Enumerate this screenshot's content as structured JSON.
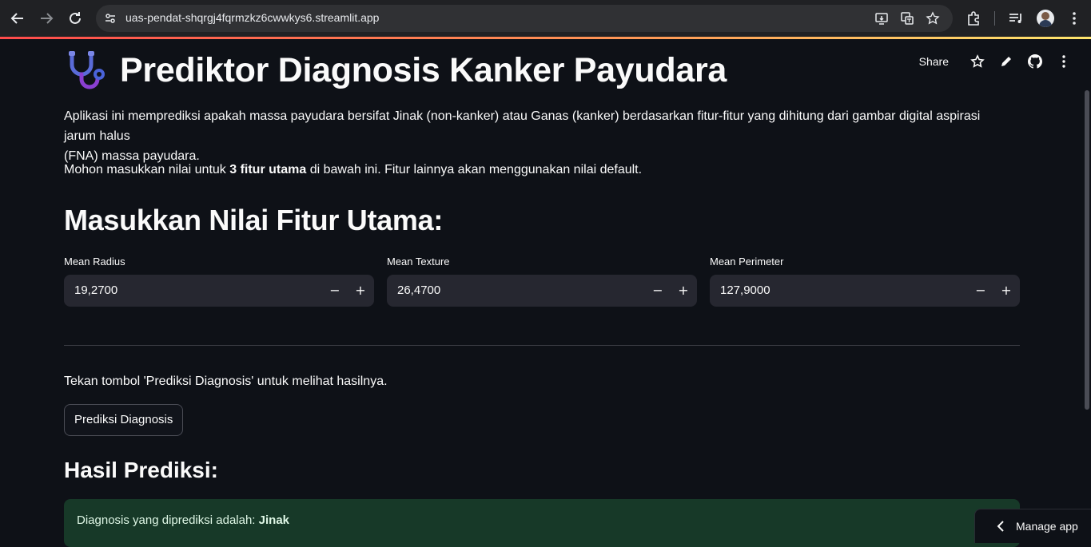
{
  "browser": {
    "url": "uas-pendat-shqrgj4fqrmzkz6cwwkys6.streamlit.app"
  },
  "toolbar": {
    "share_label": "Share"
  },
  "page": {
    "title": "Prediktor Diagnosis Kanker Payudara",
    "intro_line1": "Aplikasi ini memprediksi apakah massa payudara bersifat Jinak (non-kanker) atau Ganas (kanker) berdasarkan fitur-fitur yang dihitung dari gambar digital aspirasi jarum halus",
    "intro_line2": "(FNA) massa payudara.",
    "instruction_prefix": "Mohon masukkan nilai untuk ",
    "instruction_bold": "3 fitur utama",
    "instruction_suffix": " di bawah ini. Fitur lainnya akan menggunakan nilai default.",
    "section_title": "Masukkan Nilai Fitur Utama:",
    "hint": "Tekan tombol 'Prediksi Diagnosis' untuk melihat hasilnya.",
    "predict_label": "Prediksi Diagnosis",
    "result_title": "Hasil Prediksi:",
    "result_prefix": "Diagnosis yang diprediksi adalah: ",
    "result_value": "Jinak"
  },
  "fields": [
    {
      "label": "Mean Radius",
      "value": "19,2700"
    },
    {
      "label": "Mean Texture",
      "value": "26,4700"
    },
    {
      "label": "Mean Perimeter",
      "value": "127,9000"
    }
  ],
  "manage": {
    "label": "Manage app"
  },
  "colors": {
    "background": "#0e1117",
    "input_bg": "#262730",
    "success_bg": "#173928",
    "accent": "#ff4b4b"
  }
}
